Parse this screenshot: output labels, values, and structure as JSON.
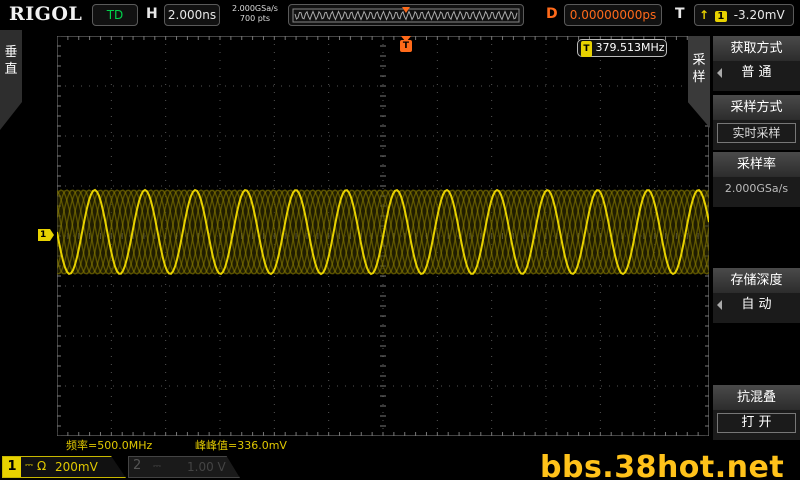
{
  "top_bar": {
    "logo": "RIGOL",
    "status": "TD",
    "h_label": "H",
    "time_scale": "2.000ns",
    "sample_rate": "2.000GSa/s",
    "memory_depth": "700 pts",
    "d_label": "D",
    "delay": "0.00000000ps",
    "t_label": "T",
    "trigger_source": "1",
    "trigger_level": "-3.20mV"
  },
  "left_tab": {
    "label_line1": "垂",
    "label_line2": "直"
  },
  "frequency_counter": "379.513MHz",
  "measurements": {
    "frequency": "频率=500.0MHz",
    "vpp": "峰峰值=336.0mV"
  },
  "menu": {
    "tab_line1": "采",
    "tab_line2": "样",
    "items": [
      {
        "title": "获取方式",
        "value": "普  通"
      },
      {
        "title": "采样方式",
        "value": "实时采样"
      },
      {
        "title": "采样率",
        "value": "2.000GSa/s"
      },
      {
        "title": "存储深度",
        "value": "自  动"
      },
      {
        "title": "抗混叠",
        "value": "打  开"
      }
    ]
  },
  "channels": [
    {
      "number": "1",
      "coupling": "⎓",
      "impedance": "Ω",
      "scale": "200mV",
      "color": "#e8d200"
    },
    {
      "number": "2",
      "coupling": "⎓",
      "scale": "1.00 V",
      "color": "#444444"
    }
  ],
  "ch1_marker": "1",
  "trigger_marker": "T",
  "watermark": "bbs.38hot.net",
  "colors": {
    "ch1": "#e8d200",
    "delay": "#ff6a1a",
    "status": "#00d24a"
  }
}
